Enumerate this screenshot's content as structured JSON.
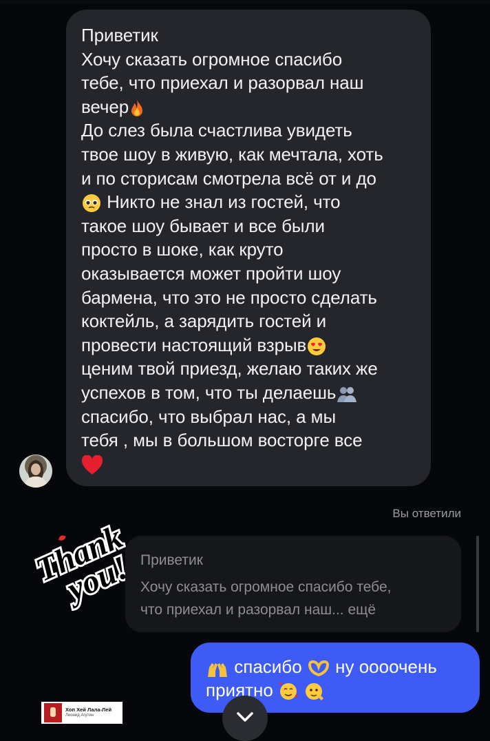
{
  "incoming_message": {
    "lines": [
      "Приветик",
      "Хочу сказать огромное спасибо",
      "тебе, что приехал и разорвал наш",
      "вечер",
      "До слез была счастлива увидеть",
      "твое шоу в живую, как мечтала, хоть",
      "и по сторисам смотрела всё от и до",
      " Никто не знал из гостей, что",
      "такое шоу бывает и все были",
      "просто в шоке, как круто",
      "оказывается может пройти шоу",
      "бармена, что это не просто сделать",
      "коктейль, а зарядить гостей и",
      "провести настоящий взрыв",
      "ценим твой приезд, желаю таких же",
      "успехов в том, что ты делаешь",
      "спасибо, что выбрал нас, а мы",
      "тебя , мы в большом восторге все"
    ]
  },
  "reply_label": "Вы ответили",
  "sticker": {
    "line1": "Thank",
    "line2": "you!"
  },
  "quoted_reply": {
    "title": "Приветик",
    "body_line1": "Хочу сказать огромное спасибо тебе,",
    "body_line2": "что приехал и разорвал наш... ещё"
  },
  "outgoing_message": {
    "part1": "спасибо",
    "part2": "ну оооочень",
    "part3": "приятно"
  },
  "music_tag": {
    "title": "Хоп Хей Лала-Лей",
    "artist": "Леонид Агутин"
  },
  "icons": [
    "fire-icon",
    "pleading-face-icon",
    "heart-eyes-icon",
    "people-icon",
    "red-heart-icon",
    "raising-hands-icon",
    "heart-hands-icon",
    "smiling-hearts-icon",
    "salute-face-icon",
    "chevron-down-icon"
  ],
  "colors": {
    "background": "#05070b",
    "incoming_bubble": "#25262b",
    "outgoing_bubble": "#3e5bf5",
    "quoted_bubble": "#16171b"
  }
}
